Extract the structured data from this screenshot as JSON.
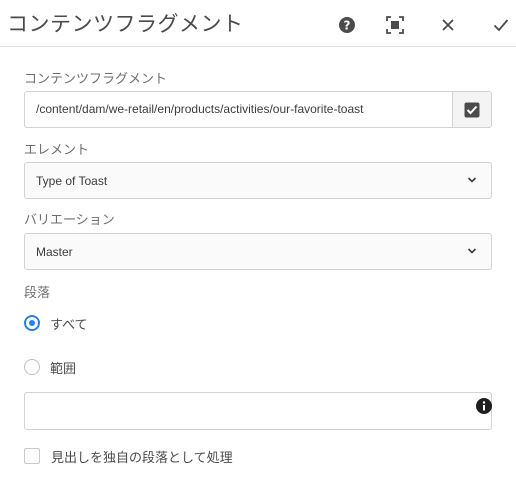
{
  "dialog": {
    "title": "コンテンツフラグメント"
  },
  "header": {
    "buttons": [
      {
        "name": "help",
        "icon": "help-circle-icon"
      },
      {
        "name": "fullscreen",
        "icon": "fullscreen-icon"
      },
      {
        "name": "close",
        "icon": "close-icon"
      },
      {
        "name": "done",
        "icon": "checkmark-icon"
      }
    ]
  },
  "fields": {
    "fragment": {
      "label": "コンテンツフラグメント",
      "value": "/content/dam/we-retail/en/products/activities/our-favorite-toast",
      "picker_icon": "checkbox-checked-icon"
    },
    "element": {
      "label": "エレメント",
      "value": "Type of Toast"
    },
    "variation": {
      "label": "バリエーション",
      "value": "Master"
    },
    "paragraphs": {
      "label": "段落",
      "option_all": "すべて",
      "option_range": "範囲",
      "selected": "すべて",
      "range_value": "",
      "info_icon": "info-icon"
    },
    "headings": {
      "label": "見出しを独自の段落として処理",
      "checked": false
    }
  },
  "colors": {
    "accent": "#2680eb",
    "text": "#4b4b4b",
    "border": "#d3d3d3"
  }
}
